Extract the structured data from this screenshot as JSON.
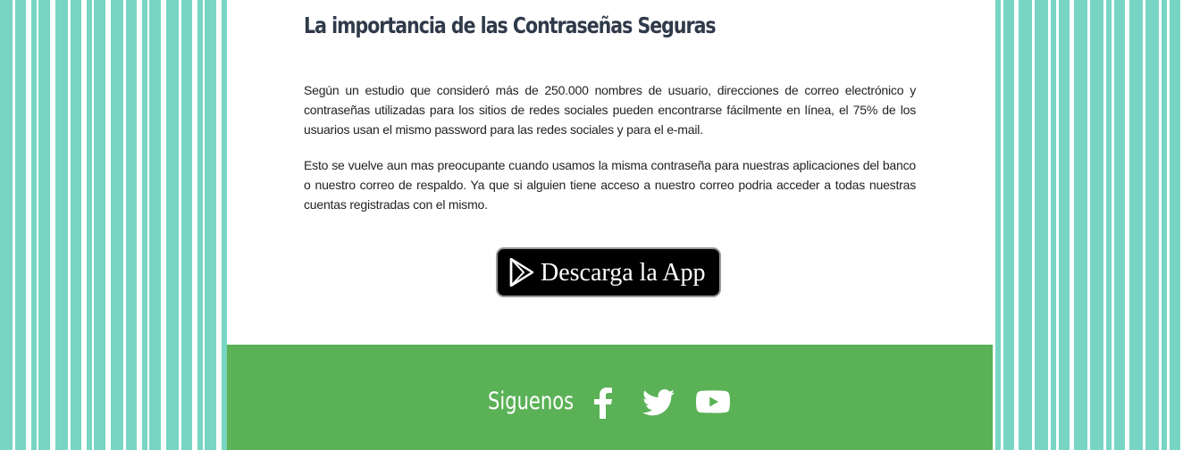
{
  "article": {
    "title": "La importancia de las Contraseñas Seguras",
    "paragraphs": [
      "Según un estudio que consideró más de 250.000 nombres de usuario, direcciones de correo electrónico y contraseñas utilizadas para los sitios de redes sociales pueden encontrarse fácilmente en línea, el 75% de los usuarios usan el mismo password para las redes sociales y para el e-mail.",
      "Esto se vuelve aun mas preocupante cuando usamos la misma contraseña para nuestras aplicaciones del banco o nuestro correo de respaldo. Ya que si alguien tiene acceso a nuestro correo podria acceder a todas nuestras cuentas registradas con el mismo."
    ]
  },
  "download_button": {
    "label": "Descarga la App",
    "icon": "google-play-icon"
  },
  "footer": {
    "follow_label": "Siguenos",
    "social_icons": [
      "facebook-icon",
      "twitter-icon",
      "youtube-icon"
    ]
  },
  "colors": {
    "stripe_accent": "#78d5c4",
    "footer_green": "#5ab156",
    "title_color": "#2f3a4a",
    "button_bg": "#000000"
  }
}
